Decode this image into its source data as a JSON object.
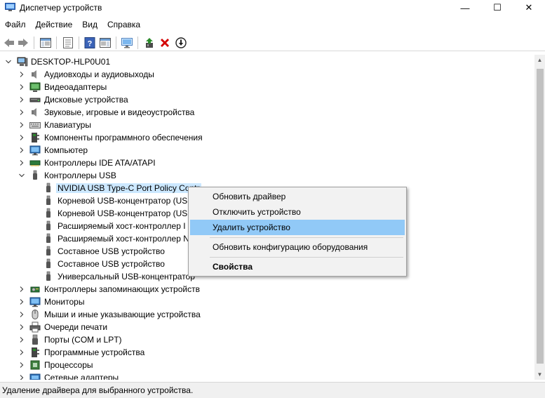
{
  "window": {
    "title": "Диспетчер устройств",
    "minimize_glyph": "—",
    "maximize_glyph": "☐",
    "close_glyph": "✕"
  },
  "menu": [
    "Файл",
    "Действие",
    "Вид",
    "Справка"
  ],
  "toolbar": {
    "icons": [
      "back-icon",
      "forward-icon",
      "show-hide-tree-icon",
      "properties-icon",
      "help-icon",
      "action-pane-icon",
      "scan-hardware-icon",
      "update-driver-icon",
      "uninstall-device-icon",
      "disable-device-icon"
    ]
  },
  "tree": {
    "root": "DESKTOP-HLP0U01",
    "categories": [
      {
        "label": "Аудиовходы и аудиовыходы",
        "icon": "speaker-icon",
        "expanded": false
      },
      {
        "label": "Видеоадаптеры",
        "icon": "display-adapter-icon",
        "expanded": false
      },
      {
        "label": "Дисковые устройства",
        "icon": "disk-drive-icon",
        "expanded": false
      },
      {
        "label": "Звуковые, игровые и видеоустройства",
        "icon": "speaker-icon",
        "expanded": false
      },
      {
        "label": "Клавиатуры",
        "icon": "keyboard-icon",
        "expanded": false
      },
      {
        "label": "Компоненты программного обеспечения",
        "icon": "software-component-icon",
        "expanded": false
      },
      {
        "label": "Компьютер",
        "icon": "monitor-icon",
        "expanded": false
      },
      {
        "label": "Контроллеры IDE ATA/ATAPI",
        "icon": "ide-controller-icon",
        "expanded": false
      },
      {
        "label": "Контроллеры USB",
        "icon": "usb-icon",
        "expanded": true
      }
    ],
    "usb_children": [
      "NVIDIA USB Type-C Port Policy Controller",
      "Корневой USB-концентратор (USB 3.0)",
      "Корневой USB-концентратор (USB 3.0)",
      "Расширяемый хост-контроллер Intel(R) USB 3.0",
      "Расширяемый хост-контроллер NVIDIA USB 3.10",
      "Составное USB устройство",
      "Составное USB устройство",
      "Универсальный USB-концентратор"
    ],
    "usb_children_visible": [
      "NVIDIA USB Type-C Port Policy Contr",
      "Корневой USB-концентратор (USB",
      "Корневой USB-концентратор (USB",
      "Расширяемый хост-контроллер I",
      "Расширяемый хост-контроллер N",
      "Составное USB устройство",
      "Составное USB устройство",
      "Универсальный USB-концентратор"
    ],
    "categories_after": [
      {
        "label": "Контроллеры запоминающих устройств",
        "icon": "storage-controller-icon"
      },
      {
        "label": "Мониторы",
        "icon": "monitor-icon"
      },
      {
        "label": "Мыши и иные указывающие устройства",
        "icon": "mouse-icon"
      },
      {
        "label": "Очереди печати",
        "icon": "printer-icon"
      },
      {
        "label": "Порты (COM и LPT)",
        "icon": "port-icon"
      },
      {
        "label": "Программные устройства",
        "icon": "software-device-icon"
      },
      {
        "label": "Процессоры",
        "icon": "processor-icon"
      },
      {
        "label": "Сетевые адаптеры",
        "icon": "network-adapter-icon"
      }
    ]
  },
  "context_menu": {
    "items": [
      {
        "label": "Обновить драйвер"
      },
      {
        "label": "Отключить устройство"
      },
      {
        "label": "Удалить устройство",
        "highlighted": true
      },
      {
        "label": "Обновить конфигурацию оборудования"
      },
      {
        "label": "Свойства",
        "bold": true
      }
    ]
  },
  "status": {
    "text": "Удаление драйвера для выбранного устройства."
  },
  "colors": {
    "selection": "#cce8ff",
    "menu_highlight": "#91c9f7",
    "uninstall_red": "#d40000",
    "update_green": "#2a8a2a"
  }
}
